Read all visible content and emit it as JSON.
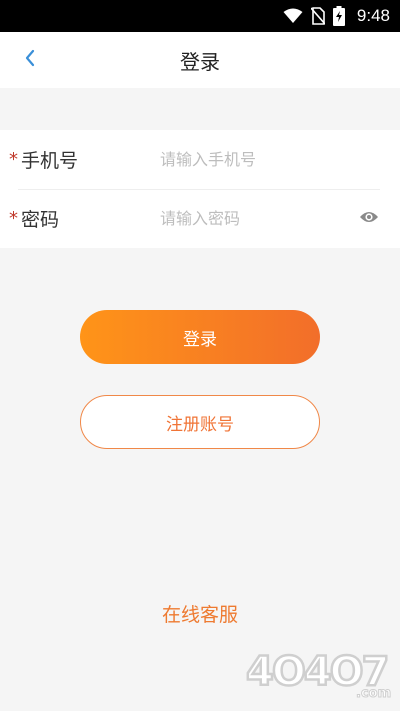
{
  "status_bar": {
    "time": "9:48",
    "icons": [
      "wifi-icon",
      "no-sim-icon",
      "battery-charging-icon"
    ]
  },
  "header": {
    "title": "登录",
    "back_icon": "chevron-left-icon"
  },
  "form": {
    "required_mark": "*",
    "phone": {
      "label": "手机号",
      "placeholder": "请输入手机号",
      "value": ""
    },
    "password": {
      "label": "密码",
      "placeholder": "请输入密码",
      "value": "",
      "toggle_icon": "eye-icon"
    }
  },
  "buttons": {
    "login_label": "登录",
    "register_label": "注册账号"
  },
  "footer": {
    "online_service_label": "在线客服"
  },
  "watermark": {
    "text": "4O4O7.com"
  },
  "colors": {
    "accent": "#f07436",
    "gradient_start": "#ff9418",
    "gradient_end": "#f26e2a",
    "required": "#c0392b",
    "back_arrow": "#3a8fd8"
  }
}
